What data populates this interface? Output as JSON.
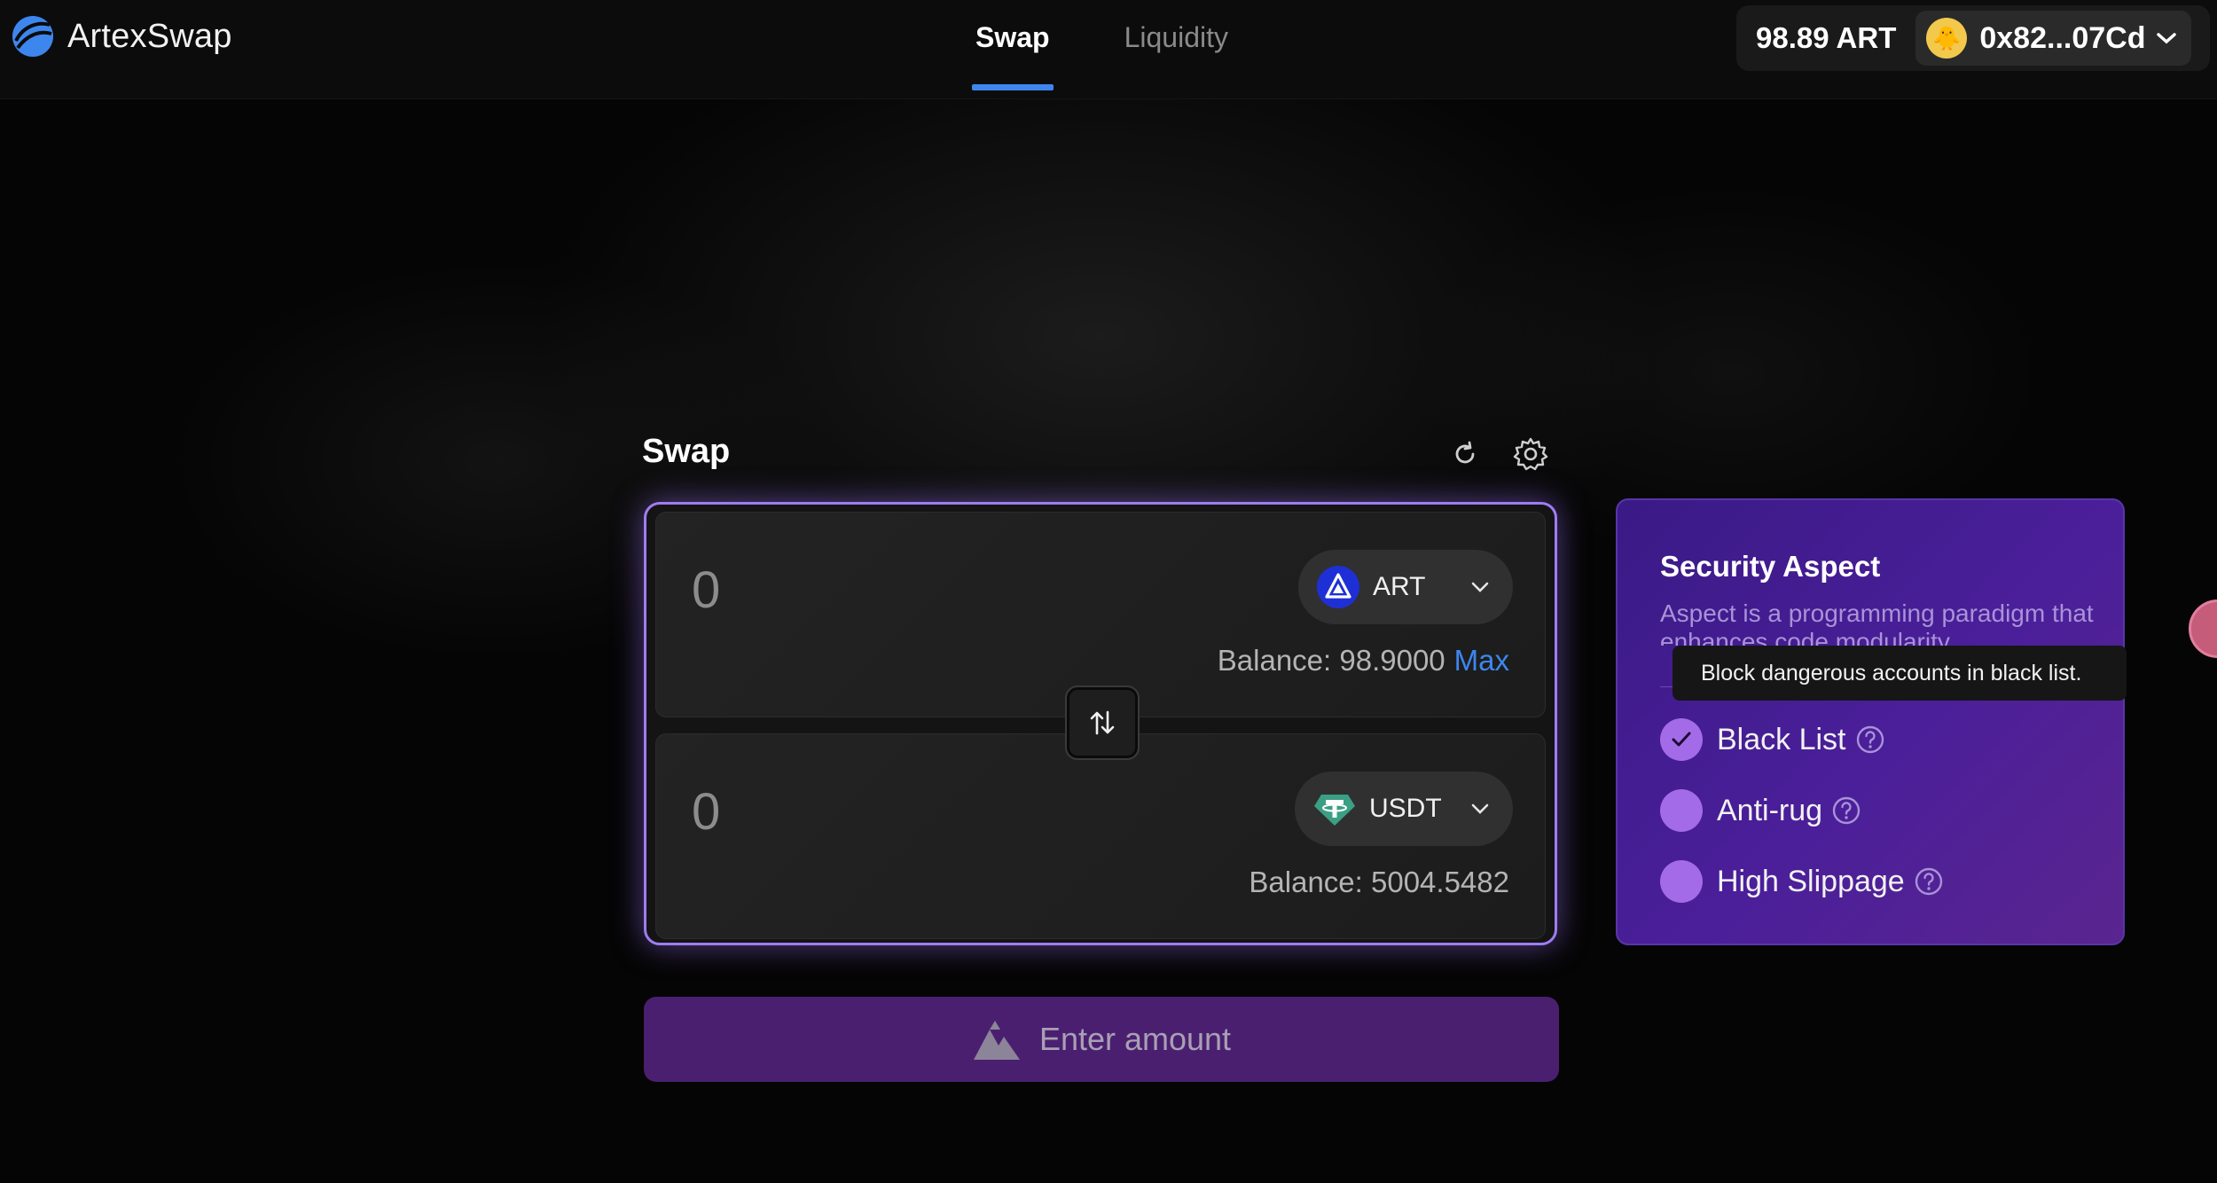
{
  "brand": {
    "name": "ArtexSwap",
    "logo_icon": "artex-logo-icon",
    "accent": "#3d86ee"
  },
  "nav": {
    "tabs": [
      {
        "label": "Swap",
        "active": true
      },
      {
        "label": "Liquidity",
        "active": false
      }
    ]
  },
  "wallet": {
    "balance": "98.89 ART",
    "address": "0x82...07Cd",
    "avatar_emoji": "🐥"
  },
  "swap": {
    "title": "Swap",
    "refresh_icon": "refresh-icon",
    "settings_icon": "gear-icon",
    "from": {
      "amount_placeholder": "0",
      "token": "ART",
      "balance_label": "Balance: 98.9000",
      "max_label": "Max"
    },
    "to": {
      "amount_placeholder": "0",
      "token": "USDT",
      "balance_label": "Balance: 5004.5482"
    },
    "flip_icon": "swap-arrows-icon",
    "submit_label": "Enter amount",
    "panel_border_color": "#9f7cf2",
    "submit_color": "#4a1f70"
  },
  "security": {
    "title": "Security Aspect",
    "description": "Aspect is a programming paradigm that enhances code modularity",
    "options": [
      {
        "label": "Black List",
        "checked": true
      },
      {
        "label": "Anti-rug",
        "checked": false
      },
      {
        "label": "High Slippage",
        "checked": false
      }
    ],
    "tooltip": "Block dangerous accounts in black list.",
    "card_color": "#4b1f9a"
  }
}
